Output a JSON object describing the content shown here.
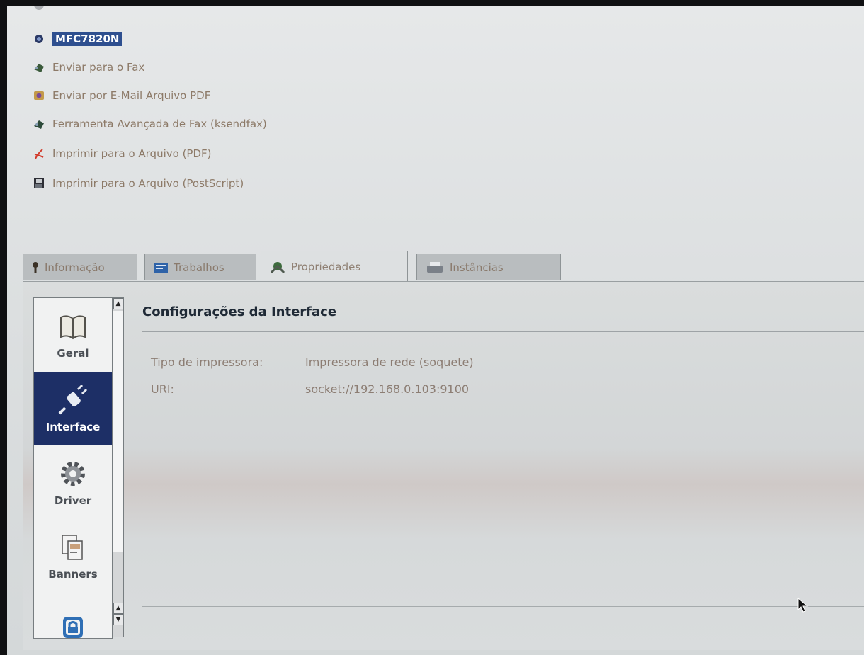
{
  "printer_list": {
    "items": [
      {
        "label": "MFC7820N",
        "icon": "printer-icon",
        "selected": true
      },
      {
        "label": "Enviar para o Fax",
        "icon": "fax-icon"
      },
      {
        "label": "Enviar por E-Mail Arquivo PDF",
        "icon": "email-pdf-icon"
      },
      {
        "label": "Ferramenta Avançada de Fax (ksendfax)",
        "icon": "fax-tool-icon"
      },
      {
        "label": "Imprimir para o Arquivo (PDF)",
        "icon": "pdf-icon"
      },
      {
        "label": "Imprimir para o Arquivo (PostScript)",
        "icon": "floppy-disk-icon"
      }
    ]
  },
  "tabs": [
    {
      "label": "Informação",
      "icon": "info-icon"
    },
    {
      "label": "Trabalhos",
      "icon": "jobs-icon"
    },
    {
      "label": "Propriedades",
      "icon": "properties-icon",
      "active": true
    },
    {
      "label": "Instâncias",
      "icon": "instances-icon"
    }
  ],
  "sidebar": {
    "items": [
      {
        "label": "Geral",
        "icon": "book-icon"
      },
      {
        "label": "Interface",
        "icon": "plug-icon",
        "active": true
      },
      {
        "label": "Driver",
        "icon": "gear-icon"
      },
      {
        "label": "Banners",
        "icon": "pages-icon"
      },
      {
        "label": "",
        "icon": "lock-icon"
      }
    ]
  },
  "section": {
    "title": "Configurações da Interface",
    "fields": [
      {
        "label": "Tipo de impressora:",
        "value": "Impressora de rede (soquete)"
      },
      {
        "label": "URI:",
        "value": "socket://192.168.0.103:9100"
      }
    ]
  },
  "colors": {
    "selection": "#2e4f8f",
    "sidebar_active": "#1d2f66",
    "text_muted": "#8c7d73"
  }
}
